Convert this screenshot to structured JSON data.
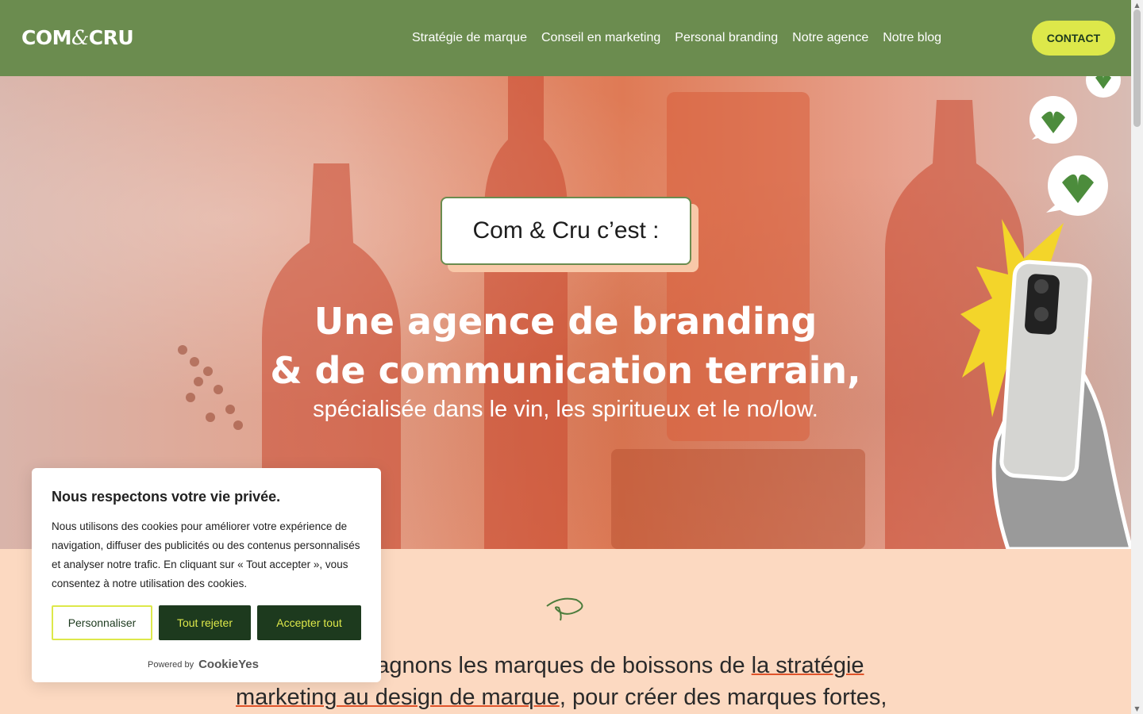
{
  "header": {
    "logo_left": "COM",
    "logo_amp": "&",
    "logo_right": "CRU",
    "nav": [
      "Stratégie de marque",
      "Conseil en marketing",
      "Personal branding",
      "Notre agence",
      "Notre blog"
    ],
    "contact_label": "CONTACT"
  },
  "hero": {
    "tag": "Com & Cru c’est :",
    "title_line1": "Une agence de branding",
    "title_line2": "& de communication terrain,",
    "subtitle": "spécialisée dans le vin, les spiritueux et le no/low."
  },
  "intro": {
    "text_before": "Nous accompagnons les marques de boissons de ",
    "link_text": "la stratégie marketing au design de marque",
    "text_after": ", pour créer des marques fortes,"
  },
  "cookie": {
    "title": "Nous respectons votre vie privée.",
    "body": "Nous utilisons des cookies pour améliorer votre expérience de navigation, diffuser des publicités ou des contenus personnalisés et analyser notre trafic. En cliquant sur « Tout accepter », vous consentez à notre utilisation des cookies.",
    "btn_customize": "Personnaliser",
    "btn_reject": "Tout rejeter",
    "btn_accept": "Accepter tout",
    "powered_by": "Powered by",
    "powered_brand": "CookieYes"
  },
  "colors": {
    "header_bg": "#6b8c4f",
    "accent_lime": "#dde84a",
    "dark_green": "#1d3a1e",
    "peach": "#fcd9c1",
    "orange": "#e0532a"
  },
  "icons": [
    "heart-bubble-icon",
    "smartphone-in-hand",
    "starburst",
    "swirl-icon"
  ]
}
